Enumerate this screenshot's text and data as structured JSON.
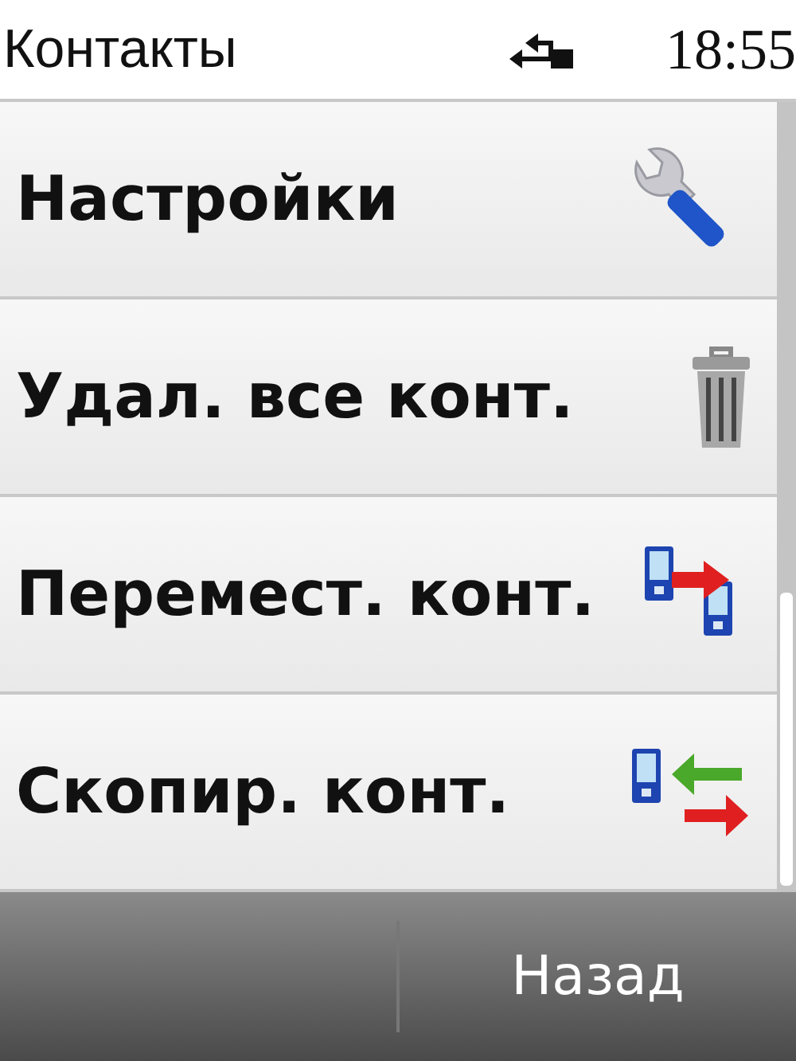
{
  "status_bar": {
    "title": "Контакты",
    "time": "18:55"
  },
  "menu": {
    "items": [
      {
        "label": "Настройки",
        "kind": "settings"
      },
      {
        "label": "Удал. все конт.",
        "kind": "delete"
      },
      {
        "label": "Перемест. конт.",
        "kind": "move"
      },
      {
        "label": "Скопир. конт.",
        "kind": "copy"
      }
    ]
  },
  "softkeys": {
    "right": "Назад"
  }
}
